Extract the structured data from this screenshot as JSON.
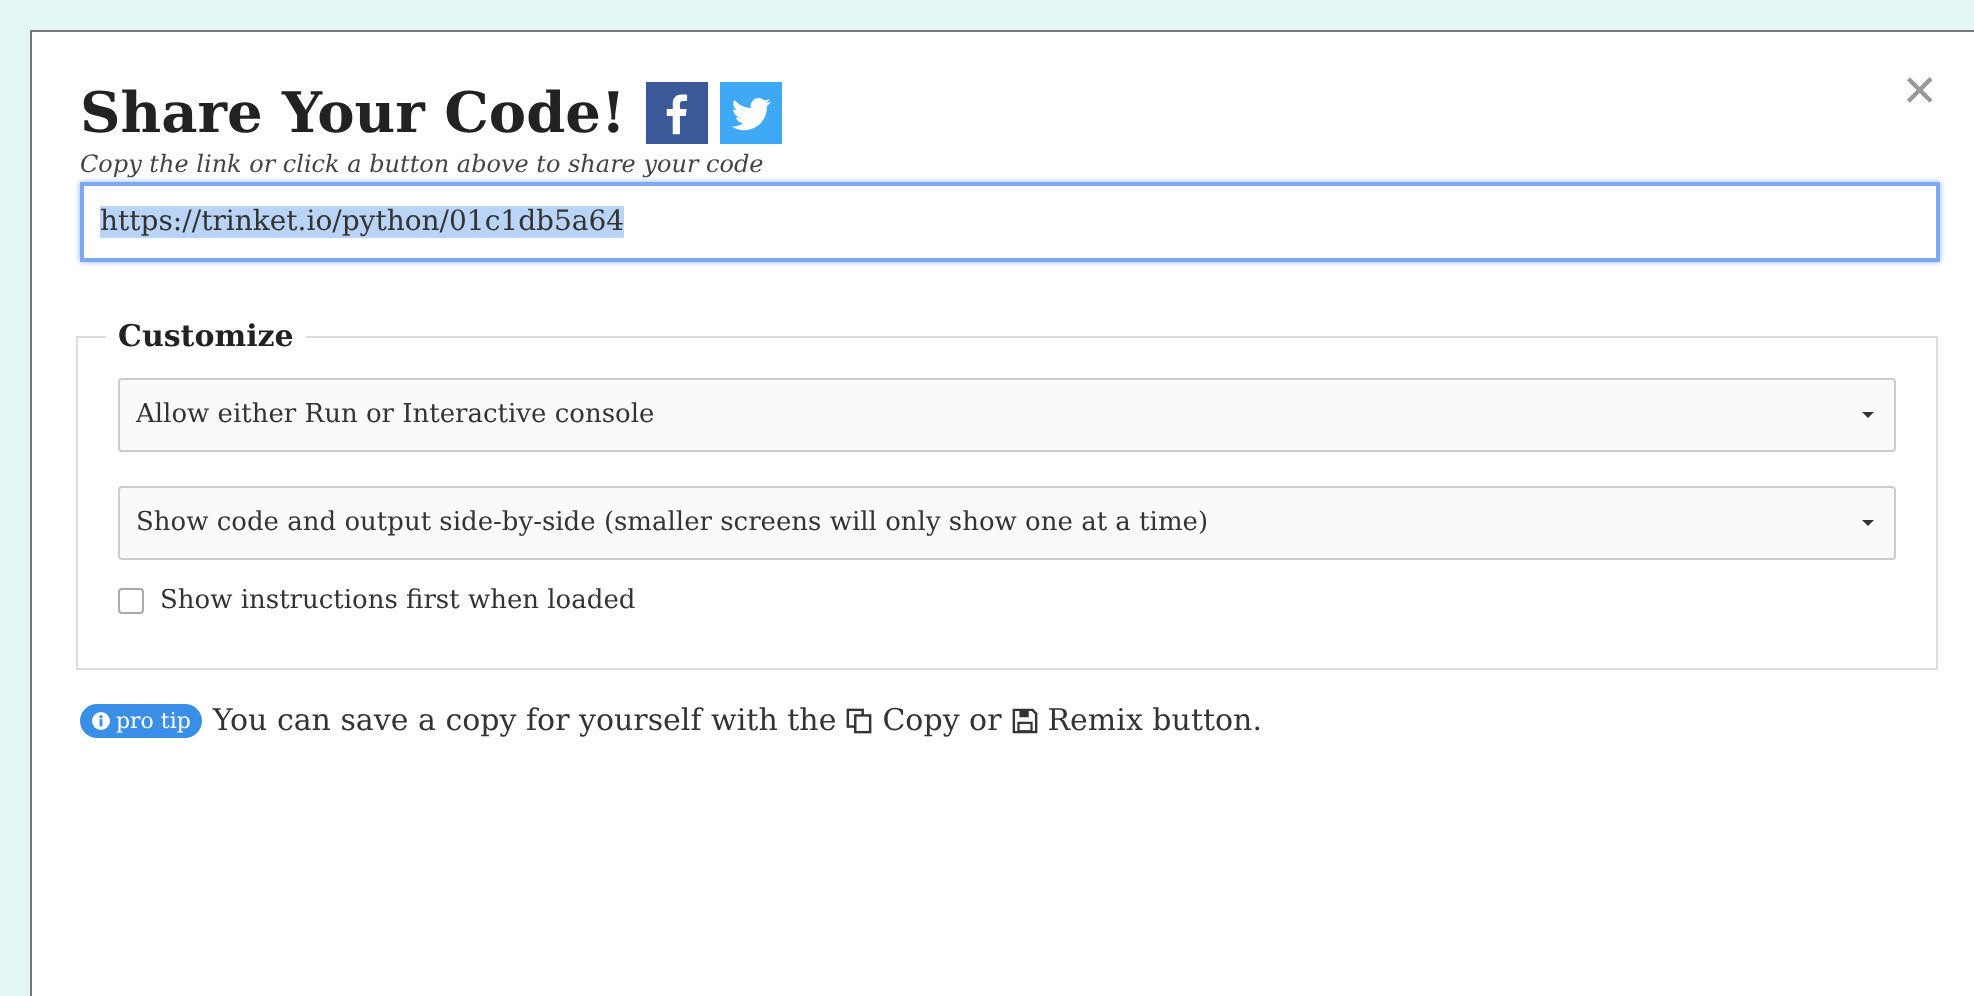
{
  "dialog": {
    "title": "Share Your Code!",
    "close": "✕",
    "subtitle": "Copy the link or click a button above to share your code",
    "link": {
      "value": "https://trinket.io/python/01c1db5a64",
      "selected": true
    },
    "customize": {
      "legend": "Customize",
      "selects": [
        {
          "value": "Allow either Run or Interactive console"
        },
        {
          "value": "Show code and output side-by-side (smaller screens will only show one at a time)"
        }
      ],
      "checkbox": {
        "label": "Show instructions first when loaded",
        "checked": false
      }
    },
    "tip": {
      "badge": "pro tip",
      "text_1": "You can save a copy for yourself with the",
      "text_2": "Copy or",
      "text_3": "Remix button."
    }
  }
}
